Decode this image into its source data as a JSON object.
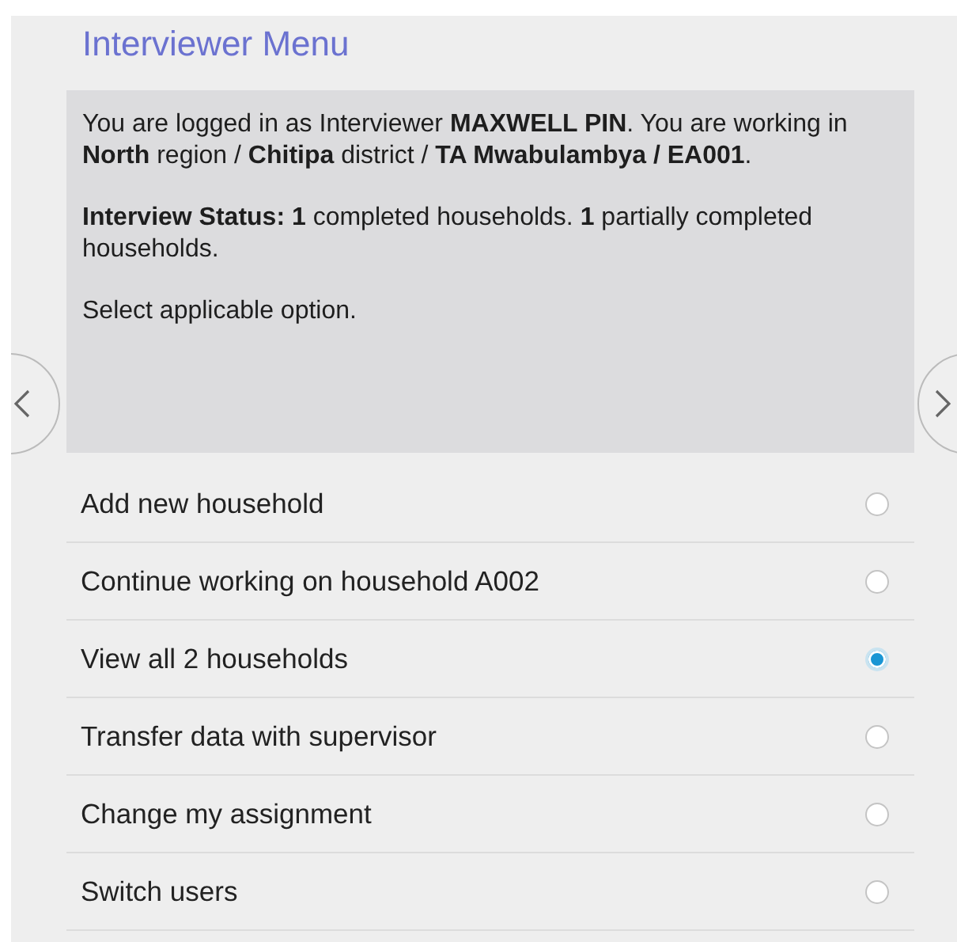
{
  "title": "Interviewer Menu",
  "info": [
    "You are logged in as Interviewer **MAXWELL PIN**. You are working in **North** region / **Chitipa** district / **TA Mwabulambya / EA001**.",
    "**Interview Status: 1** completed households. **1** partially completed households.",
    "Select applicable option."
  ],
  "options": [
    {
      "label": "Add new household",
      "selected": false
    },
    {
      "label": "Continue working on household A002",
      "selected": false
    },
    {
      "label": "View all 2 households",
      "selected": true
    },
    {
      "label": "Transfer data with supervisor",
      "selected": false
    },
    {
      "label": "Change my assignment",
      "selected": false
    },
    {
      "label": "Switch users",
      "selected": false
    }
  ]
}
